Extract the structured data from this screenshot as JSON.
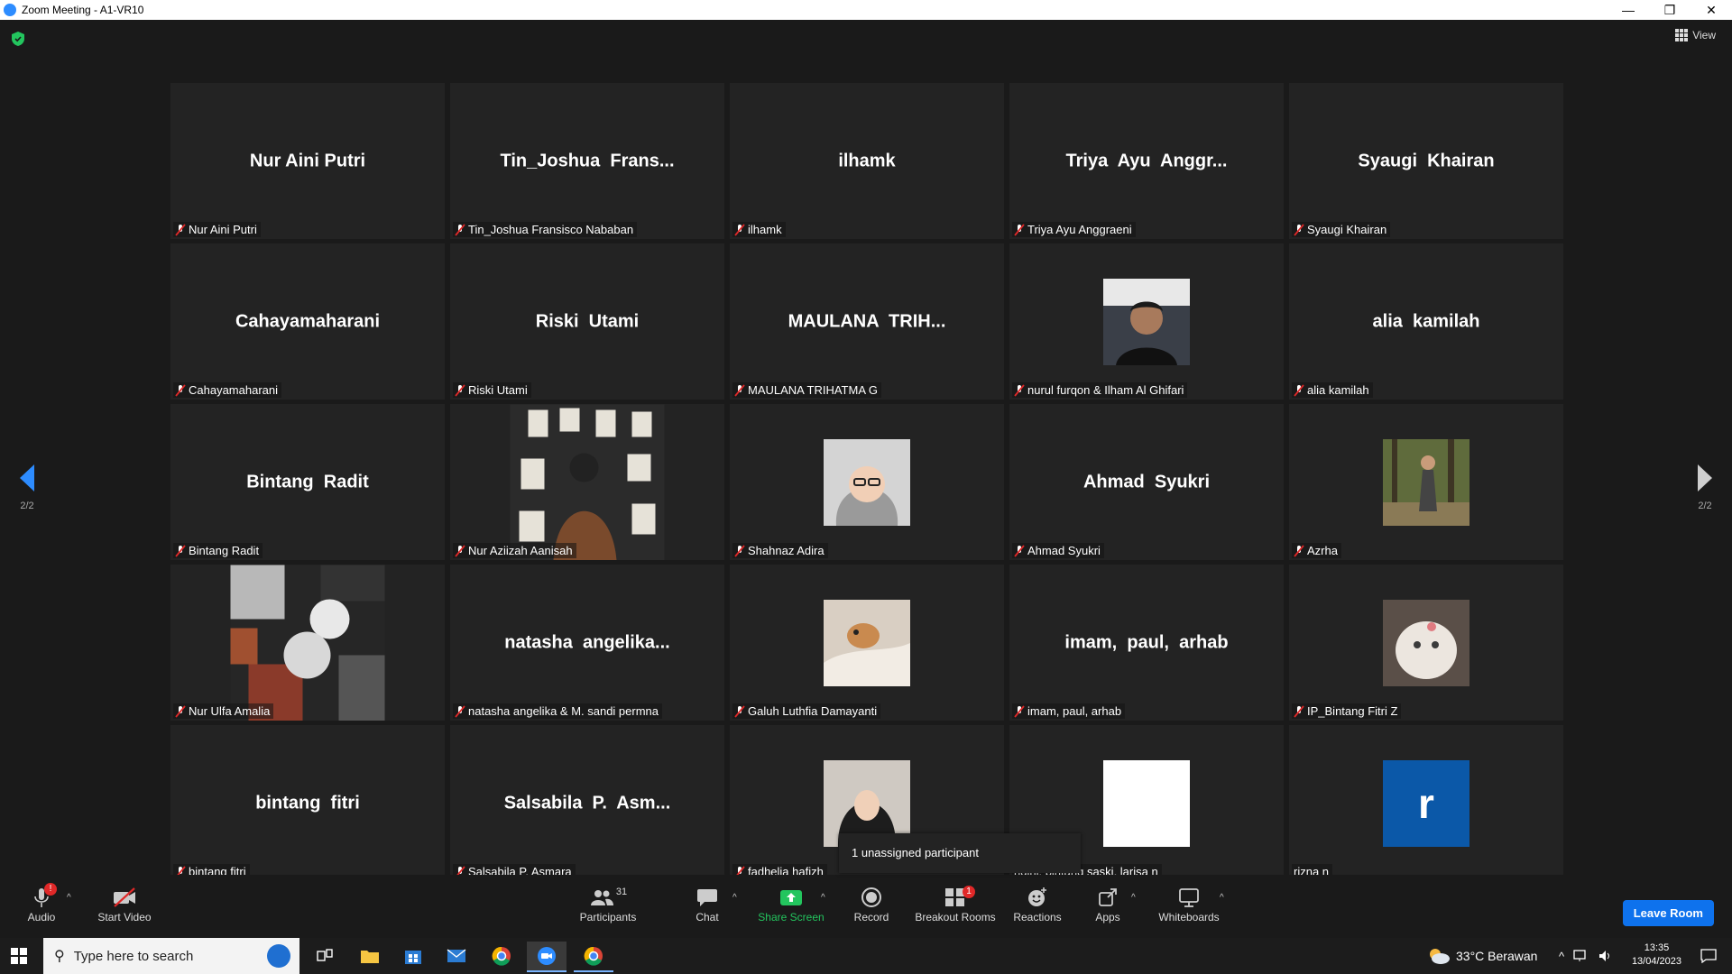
{
  "window": {
    "title": "Zoom Meeting - A1-VR10"
  },
  "view_button": {
    "label": "View"
  },
  "pager": {
    "left_label": "2/2",
    "right_label": "2/2"
  },
  "tiles": [
    {
      "display": "Nur Aini Putri",
      "label": "Nur Aini Putri"
    },
    {
      "display": "Tin_Joshua  Frans...",
      "label": "Tin_Joshua Fransisco Nababan"
    },
    {
      "display": "ilhamk",
      "label": "ilhamk"
    },
    {
      "display": "Triya  Ayu  Anggr...",
      "label": "Triya Ayu Anggraeni"
    },
    {
      "display": "Syaugi  Khairan",
      "label": "Syaugi Khairan"
    },
    {
      "display": "Cahayamaharani",
      "label": "Cahayamaharani"
    },
    {
      "display": "Riski  Utami",
      "label": "Riski Utami"
    },
    {
      "display": "MAULANA  TRIH...",
      "label": "MAULANA TRIHATMA G"
    },
    {
      "display": "",
      "label": "nurul furqon & Ilham Al Ghifari"
    },
    {
      "display": "alia  kamilah",
      "label": "alia kamilah"
    },
    {
      "display": "Bintang  Radit",
      "label": "Bintang Radit"
    },
    {
      "display": "",
      "label": "Nur Aziizah Aanisah"
    },
    {
      "display": "",
      "label": "Shahnaz Adira"
    },
    {
      "display": "Ahmad  Syukri",
      "label": "Ahmad Syukri"
    },
    {
      "display": "",
      "label": "Azrha"
    },
    {
      "display": "",
      "label": "Nur Ulfa Amalia"
    },
    {
      "display": "natasha  angelika...",
      "label": "natasha angelika & M. sandi permna"
    },
    {
      "display": "",
      "label": "Galuh Luthfia Damayanti"
    },
    {
      "display": "imam,  paul,  arhab",
      "label": "imam, paul, arhab"
    },
    {
      "display": "",
      "label": "IP_Bintang Fitri Z"
    },
    {
      "display": "bintang  fitri",
      "label": "bintang fitri"
    },
    {
      "display": "Salsabila  P.  Asm...",
      "label": "Salsabila P. Asmara"
    },
    {
      "display": "",
      "label": "fadhelia hafizh"
    },
    {
      "display": "",
      "label": "ndini, bintang saski, larisa n"
    },
    {
      "display": "r",
      "label": "rizna n"
    }
  ],
  "tooltip": {
    "text": "1 unassigned participant"
  },
  "toolbar": {
    "audio": "Audio",
    "audio_badge": "!",
    "start_video": "Start Video",
    "participants": "Participants",
    "participants_count": "31",
    "chat": "Chat",
    "share_screen": "Share Screen",
    "record": "Record",
    "breakout_rooms": "Breakout Rooms",
    "breakout_badge": "1",
    "reactions": "Reactions",
    "apps": "Apps",
    "whiteboards": "Whiteboards",
    "leave": "Leave Room"
  },
  "taskbar": {
    "search_placeholder": "Type here to search",
    "weather": "33°C  Berawan",
    "time": "13:35",
    "date": "13/04/2023"
  },
  "colors": {
    "accent": "#2d8cff",
    "share_green": "#23c55e",
    "leave_blue": "#0e72ed",
    "muted_red": "#e02828"
  }
}
